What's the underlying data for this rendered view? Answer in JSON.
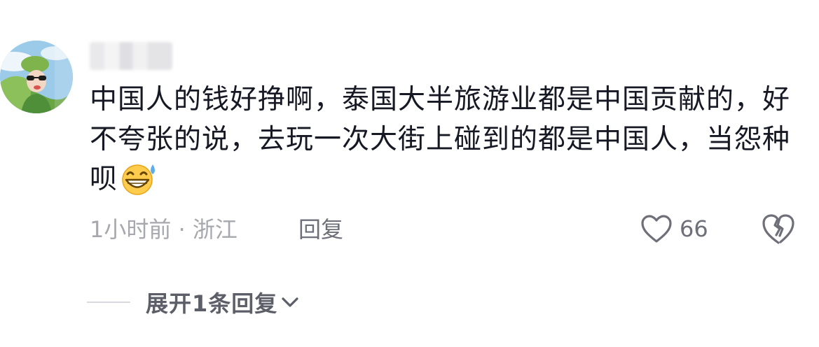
{
  "comment": {
    "avatar_icon": "user-avatar",
    "username": "",
    "text": "中国人的钱好挣啊，泰国大半旅游业都是中国贡献的，好不夸张的说，去玩一次大街上碰到的都是中国人，当怨种呗",
    "emoji_icon": "grinning-sweat-emoji",
    "time_location": "1小时前 · 浙江",
    "reply_label": "回复",
    "like_icon": "heart-outline-icon",
    "like_count": "66",
    "dislike_icon": "broken-heart-icon",
    "expand_label": "展开1条回复",
    "expand_icon": "chevron-down-icon"
  }
}
